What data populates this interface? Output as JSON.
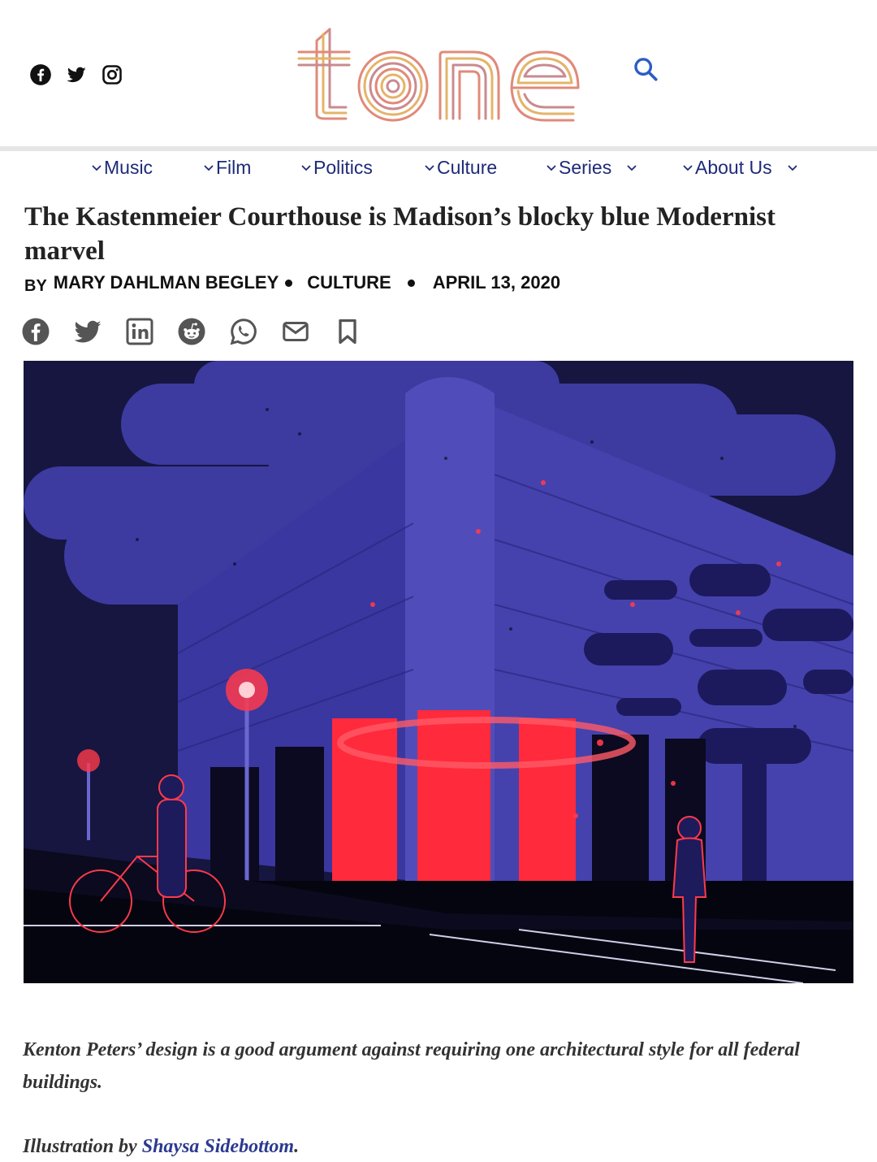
{
  "header": {
    "logo_text": "tone",
    "social_icons": [
      "facebook-icon",
      "twitter-icon",
      "instagram-icon"
    ],
    "search_icon": "search-icon"
  },
  "nav": {
    "items": [
      {
        "label": "Music",
        "has_submenu": false
      },
      {
        "label": "Film",
        "has_submenu": false
      },
      {
        "label": "Politics",
        "has_submenu": false
      },
      {
        "label": "Culture",
        "has_submenu": false
      },
      {
        "label": "Series",
        "has_submenu": true
      },
      {
        "label": "About Us",
        "has_submenu": true
      }
    ]
  },
  "article": {
    "title": "The Kastenmeier Courthouse is Madison’s blocky blue Modernist marvel",
    "by_label": "BY",
    "author": "MARY DAHLMAN BEGLEY",
    "category": "CULTURE",
    "date": "APRIL 13, 2020",
    "share_icons": [
      "facebook-icon",
      "twitter-icon",
      "linkedin-icon",
      "reddit-icon",
      "whatsapp-icon",
      "email-icon",
      "bookmark-icon"
    ],
    "caption": " Kenton Peters’ design is a good argument against requiring one architectural style for all federal buildings.",
    "credit_prefix": "Illustration by ",
    "credit_name": "Shaysa Sidebottom",
    "credit_suffix": "."
  },
  "colors": {
    "nav_text": "#1e2a78",
    "link": "#2b3a8f",
    "search": "#2b5cc7",
    "illustration_blue": "#3d3aa0",
    "illustration_red": "#ff2a3c"
  }
}
